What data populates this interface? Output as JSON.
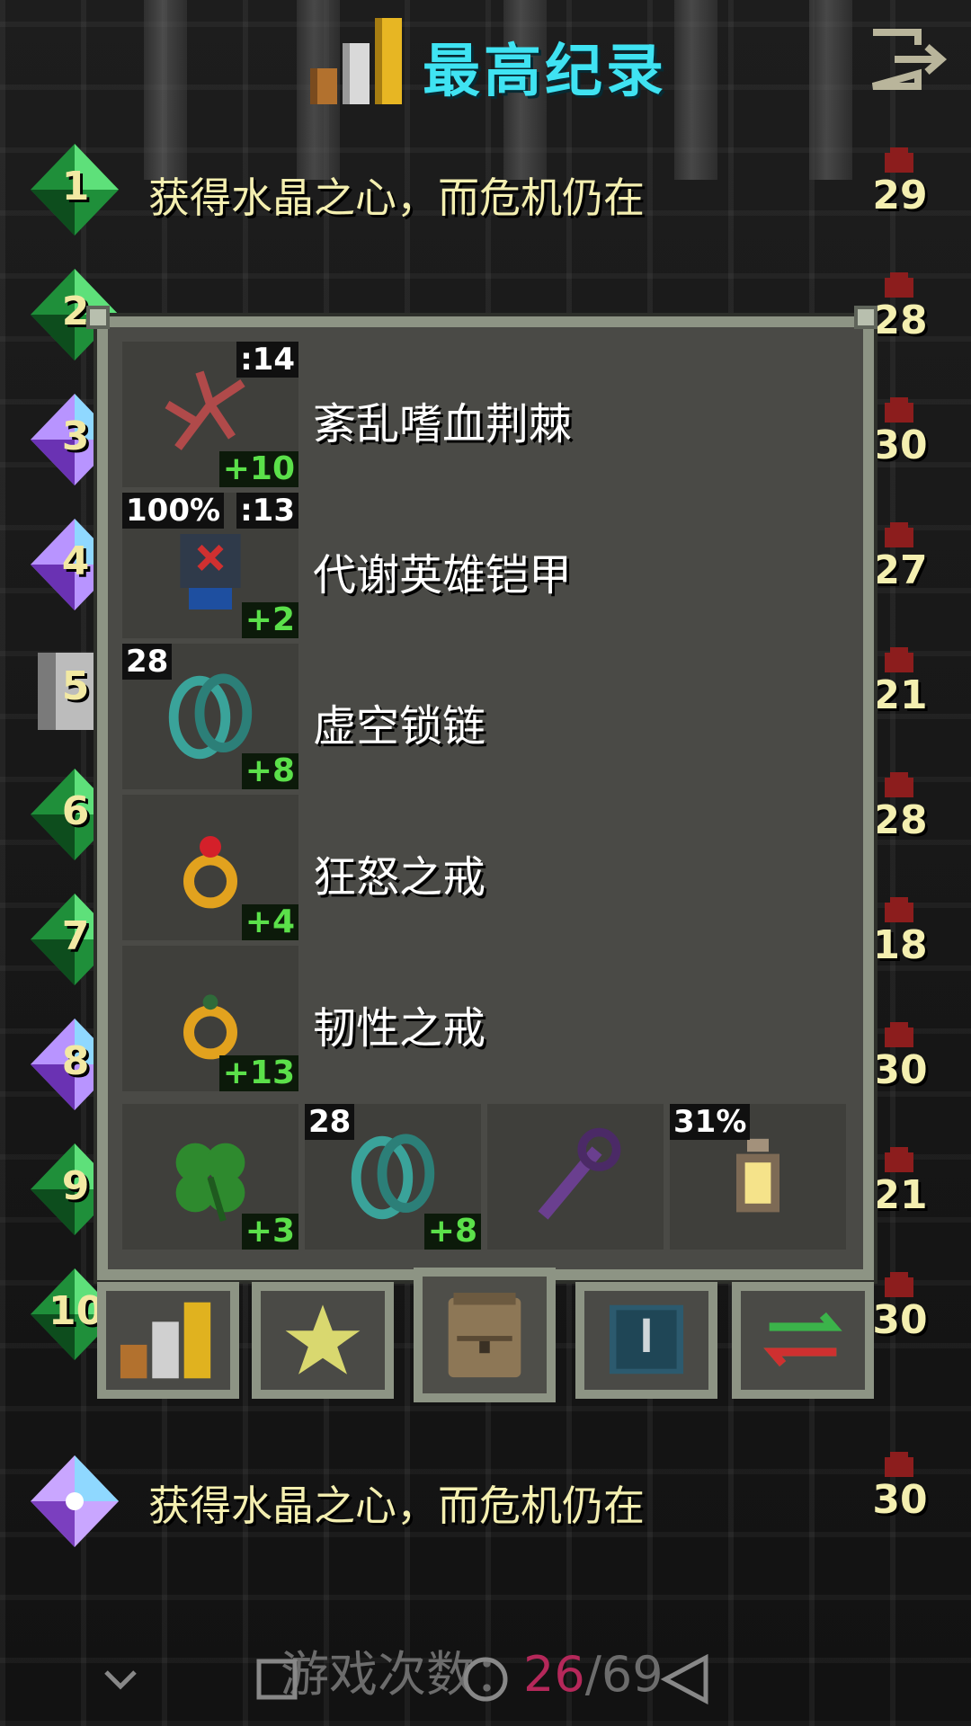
{
  "header": {
    "title": "最高纪录"
  },
  "records": [
    {
      "rank": "1",
      "text": "获得水晶之心，而危机仍在",
      "score": "29",
      "gem": "green"
    },
    {
      "rank": "2",
      "text": "",
      "score": "28",
      "gem": "green"
    },
    {
      "rank": "3",
      "text": "",
      "score": "30",
      "gem": "crystal"
    },
    {
      "rank": "4",
      "text": "",
      "score": "27",
      "gem": "crystal"
    },
    {
      "rank": "5",
      "text": "",
      "score": "21",
      "gem": "grave"
    },
    {
      "rank": "6",
      "text": "",
      "score": "28",
      "gem": "green"
    },
    {
      "rank": "7",
      "text": "",
      "score": "18",
      "gem": "green"
    },
    {
      "rank": "8",
      "text": "",
      "score": "30",
      "gem": "crystal"
    },
    {
      "rank": "9",
      "text": "",
      "score": "21",
      "gem": "green"
    },
    {
      "rank": "10",
      "text": "",
      "score": "30",
      "gem": "green"
    }
  ],
  "current_record": {
    "text": "获得水晶之心，而危机仍在",
    "score": "30"
  },
  "items": [
    {
      "name": "紊乱嗜血荆棘",
      "top_right": ":14",
      "top_left": "",
      "bonus": "+10",
      "icon": "thorns-icon"
    },
    {
      "name": "代谢英雄铠甲",
      "top_right": ":13",
      "top_left": "100%",
      "bonus": "+2",
      "icon": "armor-icon"
    },
    {
      "name": "虚空锁链",
      "top_right": "",
      "top_left": "28",
      "bonus": "+8",
      "icon": "chains-icon"
    },
    {
      "name": "狂怒之戒",
      "top_right": "",
      "top_left": "",
      "bonus": "+4",
      "icon": "ring-fury-icon"
    },
    {
      "name": "韧性之戒",
      "top_right": "",
      "top_left": "",
      "bonus": "+13",
      "icon": "ring-tenacity-icon"
    }
  ],
  "quick_slots": [
    {
      "icon": "clover-icon",
      "top_left": "",
      "bonus": "+3"
    },
    {
      "icon": "chains-icon",
      "top_left": "28",
      "bonus": "+8"
    },
    {
      "icon": "wand-icon",
      "top_left": "",
      "bonus": ""
    },
    {
      "icon": "lantern-icon",
      "top_left": "31%",
      "bonus": ""
    }
  ],
  "footer": {
    "label": "游戏次数：",
    "current": "26",
    "separator": "/",
    "total": "69"
  },
  "colors": {
    "title": "#3fe3f2",
    "record_text": "#f4efb0",
    "bonus": "#5be04a",
    "current_count": "#b5285a"
  }
}
